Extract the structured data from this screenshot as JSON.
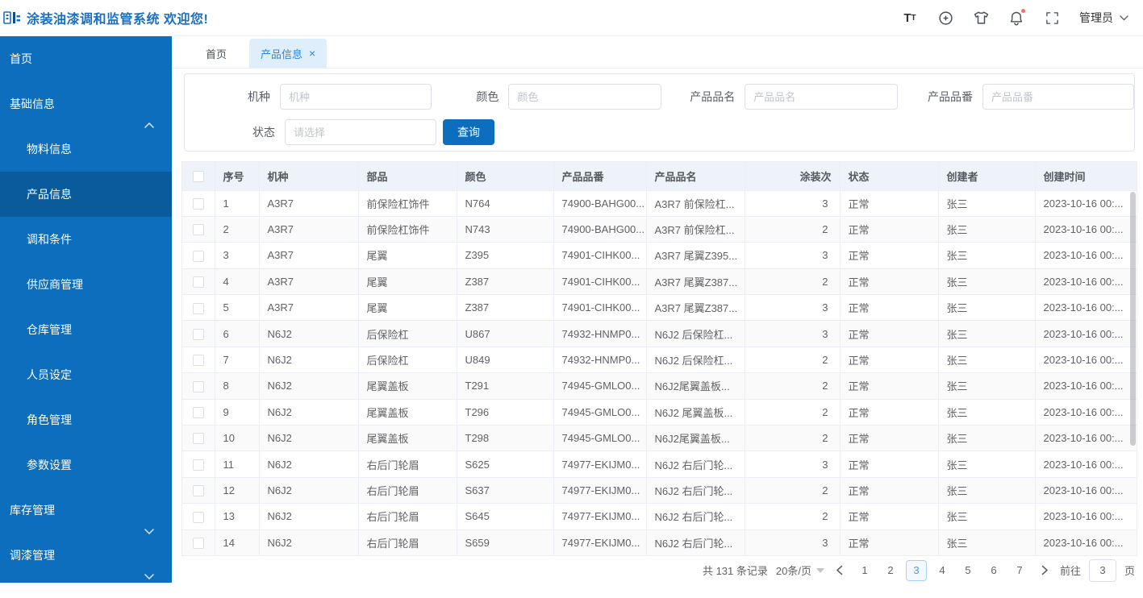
{
  "header": {
    "title": "涂装油漆调和监管系统 欢迎您!",
    "user": "管理员",
    "font_icon_big": "T",
    "font_icon_small": "T"
  },
  "sidebar": {
    "items": [
      {
        "label": "首页"
      },
      {
        "label": "基础信息"
      },
      {
        "label": "物料信息"
      },
      {
        "label": "产品信息"
      },
      {
        "label": "调和条件"
      },
      {
        "label": "供应商管理"
      },
      {
        "label": "仓库管理"
      },
      {
        "label": "人员设定"
      },
      {
        "label": "角色管理"
      },
      {
        "label": "参数设置"
      },
      {
        "label": "库存管理"
      },
      {
        "label": "调漆管理"
      }
    ]
  },
  "tabs": [
    {
      "label": "首页"
    },
    {
      "label": "产品信息",
      "close_glyph": "×"
    }
  ],
  "search": {
    "fields": [
      {
        "label": "机种",
        "placeholder": "机种"
      },
      {
        "label": "颜色",
        "placeholder": "颜色"
      },
      {
        "label": "产品品名",
        "placeholder": "产品品名"
      },
      {
        "label": "产品品番",
        "placeholder": "产品品番"
      }
    ],
    "status_label": "状态",
    "status_placeholder": "请选择",
    "submit_label": "查询"
  },
  "table": {
    "columns": [
      {
        "label": "序号"
      },
      {
        "label": "机种"
      },
      {
        "label": "部品"
      },
      {
        "label": "颜色"
      },
      {
        "label": "产品品番"
      },
      {
        "label": "产品品名"
      },
      {
        "label": "涂装次"
      },
      {
        "label": "状态"
      },
      {
        "label": "创建者"
      },
      {
        "label": "创建时间"
      }
    ],
    "rows": [
      [
        "1",
        "A3R7",
        "前保险杠饰件",
        "N764",
        "74900-BAHG00...",
        "A3R7 前保险杠...",
        "3",
        "正常",
        "张三",
        "2023-10-16 00:..."
      ],
      [
        "2",
        "A3R7",
        "前保险杠饰件",
        "N743",
        "74900-BAHG00...",
        "A3R7 前保险杠...",
        "2",
        "正常",
        "张三",
        "2023-10-16 00:..."
      ],
      [
        "3",
        "A3R7",
        "尾翼",
        "Z395",
        "74901-CIHK00...",
        "A3R7 尾翼Z395...",
        "3",
        "正常",
        "张三",
        "2023-10-16 00:..."
      ],
      [
        "4",
        "A3R7",
        "尾翼",
        "Z387",
        "74901-CIHK00...",
        "A3R7 尾翼Z387...",
        "2",
        "正常",
        "张三",
        "2023-10-16 00:..."
      ],
      [
        "5",
        "A3R7",
        "尾翼",
        "Z387",
        "74901-CIHK00...",
        "A3R7 尾翼Z387...",
        "3",
        "正常",
        "张三",
        "2023-10-16 00:..."
      ],
      [
        "6",
        "N6J2",
        "后保险杠",
        "U867",
        "74932-HNMP0...",
        "N6J2 后保险杠...",
        "3",
        "正常",
        "张三",
        "2023-10-16 00:..."
      ],
      [
        "7",
        "N6J2",
        "后保险杠",
        "U849",
        "74932-HNMP0...",
        "N6J2 后保险杠...",
        "2",
        "正常",
        "张三",
        "2023-10-16 00:..."
      ],
      [
        "8",
        "N6J2",
        "尾翼盖板",
        "T291",
        "74945-GMLO0...",
        "N6J2尾翼盖板...",
        "2",
        "正常",
        "张三",
        "2023-10-16 00:..."
      ],
      [
        "9",
        "N6J2",
        "尾翼盖板",
        "T296",
        "74945-GMLO0...",
        "N6J2 尾翼盖板...",
        "2",
        "正常",
        "张三",
        "2023-10-16 00:..."
      ],
      [
        "10",
        "N6J2",
        "尾翼盖板",
        "T298",
        "74945-GMLO0...",
        "N6J2尾翼盖板...",
        "2",
        "正常",
        "张三",
        "2023-10-16 00:..."
      ],
      [
        "11",
        "N6J2",
        "右后门轮眉",
        "S625",
        "74977-EKIJM0...",
        "N6J2 右后门轮...",
        "3",
        "正常",
        "张三",
        "2023-10-16 00:..."
      ],
      [
        "12",
        "N6J2",
        "右后门轮眉",
        "S637",
        "74977-EKIJM0...",
        "N6J2 右后门轮...",
        "2",
        "正常",
        "张三",
        "2023-10-16 00:..."
      ],
      [
        "13",
        "N6J2",
        "右后门轮眉",
        "S645",
        "74977-EKIJM0...",
        "N6J2 右后门轮...",
        "2",
        "正常",
        "张三",
        "2023-10-16 00:..."
      ],
      [
        "14",
        "N6J2",
        "右后门轮眉",
        "S659",
        "74977-EKIJM0...",
        "N6J2 右后门轮...",
        "3",
        "正常",
        "张三",
        "2023-10-16 00:..."
      ]
    ]
  },
  "pagination": {
    "total_text": "共 131 条记录",
    "page_size_text": "20条/页",
    "pages": [
      "1",
      "2",
      "3",
      "4",
      "5",
      "6",
      "7"
    ],
    "active_page": "3",
    "goto_label": "前往",
    "goto_value": "3",
    "page_unit": "页"
  },
  "colors": {
    "sidebar_bg": "#0c6ebc",
    "sidebar_active_bg": "#0a5b9b",
    "primary_button": "#0d6ebe",
    "title_blue": "#1c6fc0",
    "active_tab_bg": "#dfeefb",
    "active_tab_text": "#2b85e4",
    "table_header_bg": "#eef3f9",
    "notification_dot": "#f56c6c",
    "pager_active": "#409eff"
  }
}
